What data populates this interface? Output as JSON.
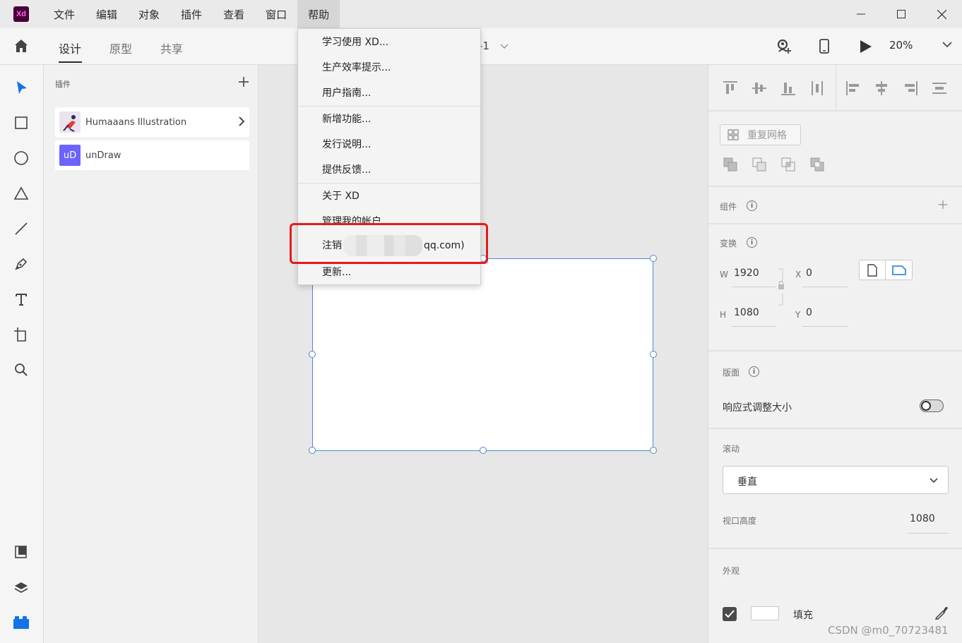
{
  "app": {
    "logo_text": "Xd",
    "menu": [
      "文件",
      "编辑",
      "对象",
      "插件",
      "查看",
      "窗口",
      "帮助"
    ],
    "active_menu": "帮助"
  },
  "toolbar": {
    "tabs": [
      "设计",
      "原型",
      "共享"
    ],
    "active_tab": "设计",
    "doc_title_fragment": "-1",
    "zoom": "20%"
  },
  "plugins": {
    "heading": "插件",
    "items": [
      {
        "name": "Humaaans Illustration",
        "thumb": "humaaans-thumbnail",
        "has_chevron": true
      },
      {
        "name": "unDraw",
        "thumb_text": "uD",
        "thumb_color": "#6c63ff",
        "has_chevron": false
      }
    ]
  },
  "help_menu": {
    "items": [
      "学习使用 XD...",
      "生产效率提示...",
      "用户指南...",
      "新增功能...",
      "发行说明...",
      "提供反馈...",
      "关于 XD",
      "管理我的帐户...",
      "注销",
      "更新..."
    ],
    "signout_suffix": "qq.com)"
  },
  "properties": {
    "component_label": "组件",
    "repeat_grid": "重复网格",
    "transform_label": "变换",
    "w_label": "W",
    "w_value": "1920",
    "h_label": "H",
    "h_value": "1080",
    "x_label": "X",
    "x_value": "0",
    "y_label": "Y",
    "y_value": "0",
    "layout_label": "版面",
    "responsive_label": "响应式调整大小",
    "responsive_on": false,
    "scroll_label": "滚动",
    "scroll_value": "垂直",
    "viewport_label": "视口高度",
    "viewport_value": "1080",
    "appearance_label": "外观",
    "fill_label": "填充",
    "fill_checked": true
  },
  "watermark": "CSDN @m0_70723481",
  "colors": {
    "accent": "#1473e6",
    "selection": "#4a8ad8",
    "highlight": "#e51a1a"
  }
}
